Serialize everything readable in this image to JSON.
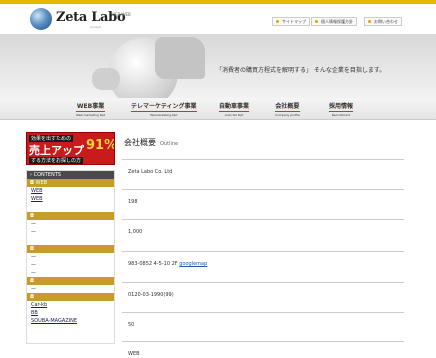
{
  "header": {
    "logo": "Zeta Labo",
    "logo_sub": "Consult",
    "tagline": "WEB/WEB",
    "util_links": [
      "サイトマップ",
      "個人情報保護方針",
      "お問い合わせ"
    ]
  },
  "banner": {
    "text": "「消費者の購買方程式を解明する」 そんな企業を目指します。"
  },
  "nav": [
    {
      "label": "WEB事業",
      "sub": "Web marketing Dpt"
    },
    {
      "label": "テレマーケティング事業",
      "sub": "Telemarketing Dpt"
    },
    {
      "label": "自動車事業",
      "sub": "Auto biz Dpt"
    },
    {
      "label": "会社概要",
      "sub": "Company profile"
    },
    {
      "label": "採用情報",
      "sub": "Recruitment"
    }
  ],
  "promo": {
    "line1": "効果を出すための",
    "line2": "売上アップ",
    "line3": "91%",
    "line4": "する方法をお探しの方"
  },
  "sidebar": {
    "contents_title": "CONTENTS",
    "sections": [
      {
        "head": "WEB",
        "links": [
          "WEB",
          "WEB"
        ]
      },
      {
        "head": "",
        "links": [
          "—",
          "—"
        ]
      },
      {
        "head": "",
        "links": [
          "—",
          "—",
          "—"
        ]
      },
      {
        "head": "",
        "links": [
          "—"
        ]
      },
      {
        "head": "",
        "links": [
          "Car-kb",
          "BB",
          "SOUBA-MAGAZINE"
        ]
      }
    ]
  },
  "content": {
    "title": "会社概要",
    "title_en": "Outline",
    "rows": [
      {
        "text": "Zeta Labo Co. Ltd",
        "link": ""
      },
      {
        "text": "198",
        "link": ""
      },
      {
        "text": "1,000",
        "link": ""
      },
      {
        "text": "983-0852 4-5-10 2F",
        "link": "googlemap"
      },
      {
        "text": "0120-03-1990(99)",
        "link": ""
      },
      {
        "text": "50",
        "link": ""
      },
      {
        "text": "WEB",
        "link": ""
      }
    ]
  }
}
